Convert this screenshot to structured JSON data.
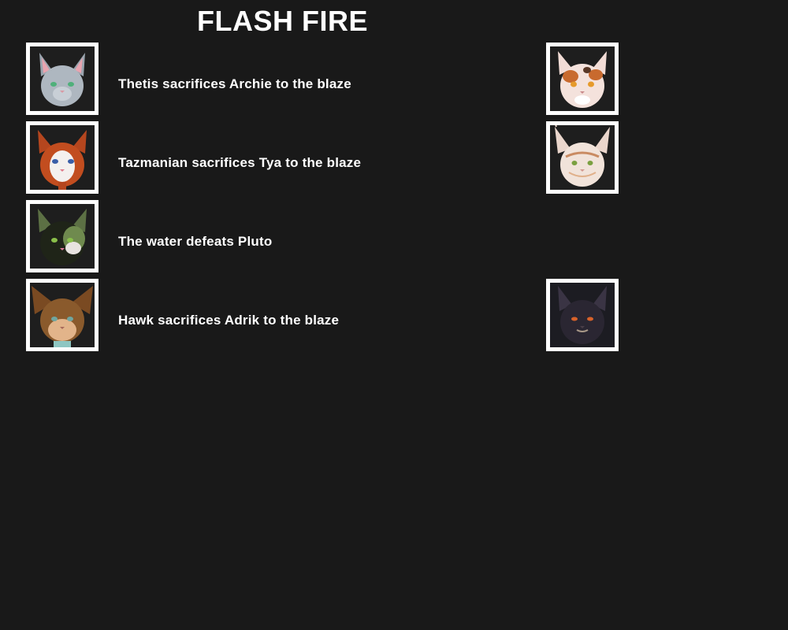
{
  "title": "FLASH FIRE",
  "events": [
    {
      "text": "Thetis sacrifices Archie to the blaze",
      "left_avatar": "grey-cat-portrait",
      "right_avatar": "calico-cat-portrait"
    },
    {
      "text": "Tazmanian sacrifices Tya to the blaze",
      "left_avatar": "ginger-white-cat-portrait",
      "right_avatar": "cream-lynx-cat-portrait"
    },
    {
      "text": "The water defeats Pluto",
      "left_avatar": "black-green-cat-portrait",
      "right_avatar": ""
    },
    {
      "text": "Hawk sacrifices Adrik to the blaze",
      "left_avatar": "brown-tabby-cat-portrait",
      "right_avatar": "dark-shadow-cat-portrait"
    }
  ],
  "colors": {
    "background": "#191919",
    "text": "#ffffff",
    "frame": "#ffffff"
  }
}
